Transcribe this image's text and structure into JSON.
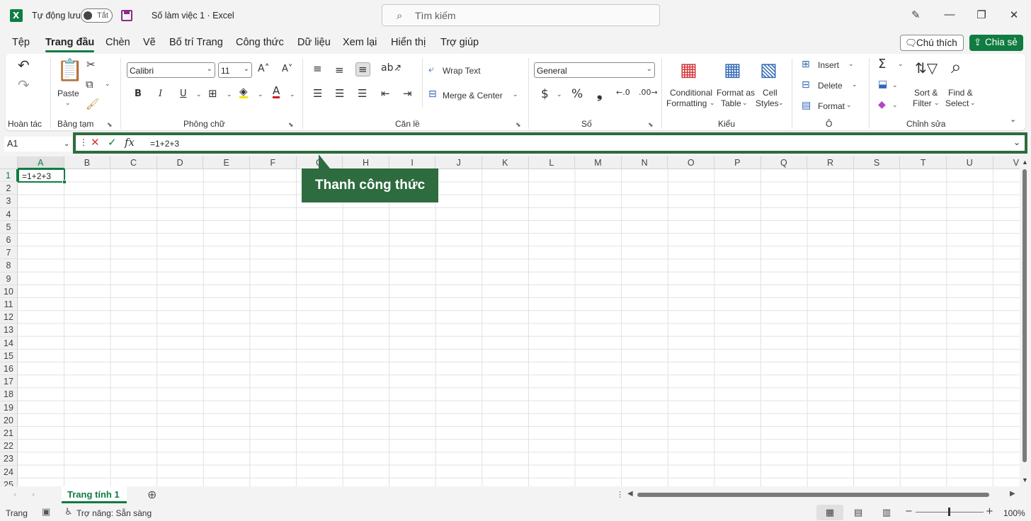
{
  "titlebar": {
    "autosave_label": "Tự động lưu",
    "toggle_state": "Tắt",
    "doc_name": "Số làm việc 1  ·  Excel",
    "search_placeholder": "Tìm kiếm",
    "search_icon": "search-icon",
    "app_icon": "excel-app-icon"
  },
  "menu": {
    "tabs": [
      "Tệp",
      "Trang đầu",
      "Chèn",
      "Vẽ",
      "Bố trí Trang",
      "Công thức",
      "Dữ liệu",
      "Xem lại",
      "Hiển thị",
      "Trợ giúp"
    ],
    "active_tab": "Trang đầu",
    "comment_label": "Chú thích",
    "share_label": "Chia sẻ"
  },
  "ribbon": {
    "undo": {
      "group_label": "Hoàn tác"
    },
    "clipboard": {
      "paste_label": "Paste",
      "group_label": "Bảng tạm"
    },
    "font": {
      "font_name": "Calibri",
      "font_size": "11",
      "bold": "B",
      "italic": "I",
      "underline": "U",
      "group_label": "Phông chữ"
    },
    "alignment": {
      "wrap_text": "Wrap Text",
      "merge_center": "Merge & Center",
      "group_label": "Căn lề"
    },
    "number": {
      "format": "General",
      "currency": "$",
      "percent": "%",
      "comma": "❟",
      "group_label": "Số"
    },
    "styles": {
      "conditional_1": "Conditional",
      "conditional_2": "Formatting",
      "format_table_1": "Format as",
      "format_table_2": "Table",
      "cell_styles_1": "Cell",
      "cell_styles_2": "Styles",
      "group_label": "Kiểu"
    },
    "cells": {
      "insert": "Insert",
      "delete": "Delete",
      "format": "Format",
      "group_label": "Ô"
    },
    "editing": {
      "sort_1": "Sort &",
      "sort_2": "Filter",
      "find_1": "Find &",
      "find_2": "Select",
      "group_label": "Chỉnh sửa"
    }
  },
  "formula_bar": {
    "name_box": "A1",
    "content": "=1+2+3"
  },
  "grid": {
    "columns": [
      "A",
      "B",
      "C",
      "D",
      "E",
      "F",
      "G",
      "H",
      "I",
      "J",
      "K",
      "L",
      "M",
      "N",
      "O",
      "P",
      "Q",
      "R",
      "S",
      "T",
      "U",
      "V"
    ],
    "rows": [
      "1",
      "2",
      "3",
      "4",
      "5",
      "6",
      "7",
      "8",
      "9",
      "10",
      "11",
      "12",
      "13",
      "14",
      "15",
      "16",
      "17",
      "18",
      "19",
      "20",
      "21",
      "22",
      "23",
      "24",
      "25"
    ],
    "selected_column": "A",
    "selected_row": "1",
    "active_cell_value": "=1+2+3"
  },
  "callout": {
    "text": "Thanh công thức"
  },
  "sheets": {
    "tabs": [
      "Trang tính 1"
    ],
    "active": "Trang tính 1"
  },
  "status": {
    "mode": "Trang",
    "accessibility": "Trợ năng: Sẵn sàng",
    "zoom": "100%"
  },
  "colors": {
    "accent": "#107c41",
    "callout": "#2e6b3e"
  }
}
